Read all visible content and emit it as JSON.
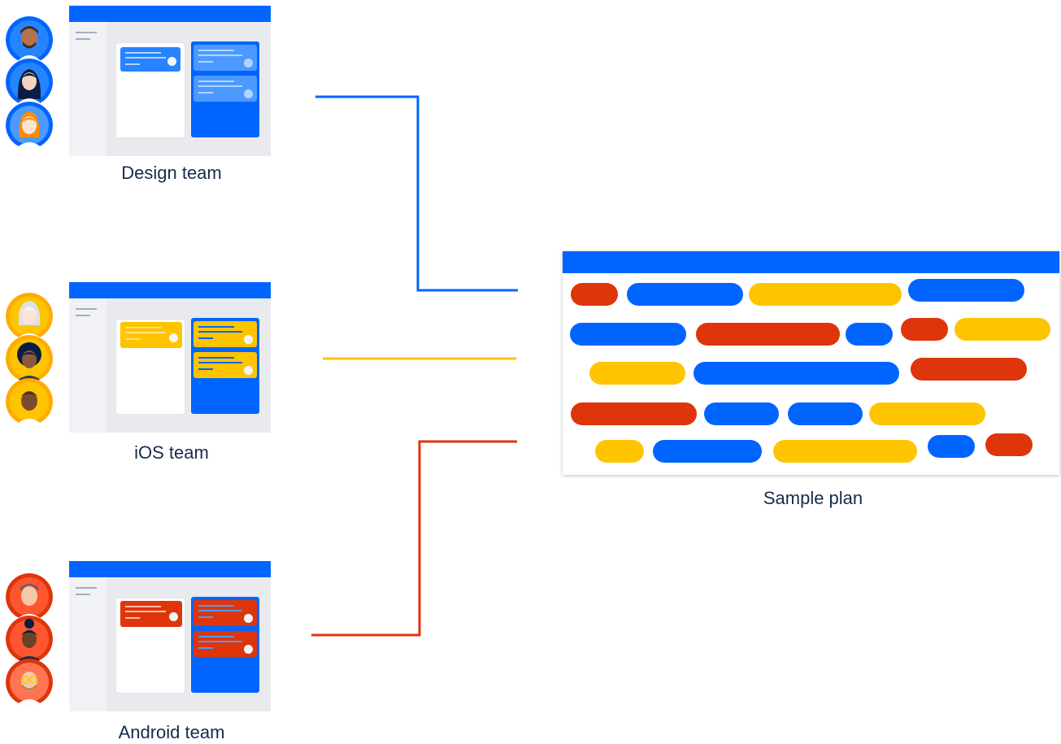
{
  "colors": {
    "blue": "#0065ff",
    "yellow": "#ffc400",
    "red": "#de350b",
    "text": "#172b4d"
  },
  "teams": [
    {
      "label": "Design team",
      "color": "blue",
      "avatars": [
        "avatar-man-beard",
        "avatar-woman-dark-hair",
        "avatar-woman-ginger"
      ]
    },
    {
      "label": "iOS team",
      "color": "yellow",
      "avatars": [
        "avatar-woman-white-hair",
        "avatar-woman-curly",
        "avatar-man-bald"
      ]
    },
    {
      "label": "Android team",
      "color": "red",
      "avatars": [
        "avatar-man-glasses",
        "avatar-woman-bun",
        "avatar-man-beard-glasses"
      ]
    }
  ],
  "plan": {
    "label": "Sample plan",
    "rows": [
      [
        "red",
        "blue",
        "yellow",
        "blue"
      ],
      [
        "blue",
        "red",
        "blue",
        "red",
        "yellow"
      ],
      [
        "yellow",
        "blue",
        "red"
      ],
      [
        "red",
        "blue",
        "blue",
        "yellow"
      ],
      [
        "yellow",
        "blue",
        "yellow",
        "blue",
        "red"
      ]
    ]
  }
}
